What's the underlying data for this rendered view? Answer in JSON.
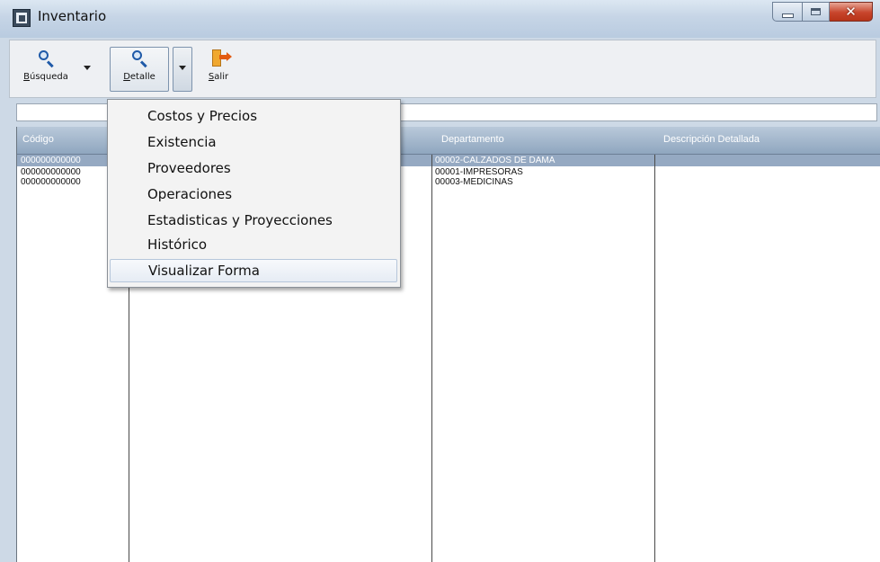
{
  "window": {
    "title": "Inventario"
  },
  "toolbar": {
    "busqueda_label": "Búsqueda",
    "detalle_label": "Detalle",
    "salir_label": "Salir"
  },
  "search": {
    "value": ""
  },
  "grid": {
    "headers": [
      "Código",
      "",
      "Departamento",
      "Descripción Detallada"
    ],
    "rows": [
      {
        "codigo": "000000000000",
        "departamento": "00002-CALZADOS DE DAMA"
      },
      {
        "codigo": "000000000000",
        "departamento": "00001-IMPRESORAS"
      },
      {
        "codigo": "000000000000",
        "departamento": "00003-MEDICINAS"
      }
    ]
  },
  "menu": {
    "items": [
      "Costos y Precios",
      "Existencia",
      "Proveedores",
      "Operaciones",
      "Estadisticas y Proyecciones",
      "Histórico",
      "Visualizar Forma"
    ]
  }
}
